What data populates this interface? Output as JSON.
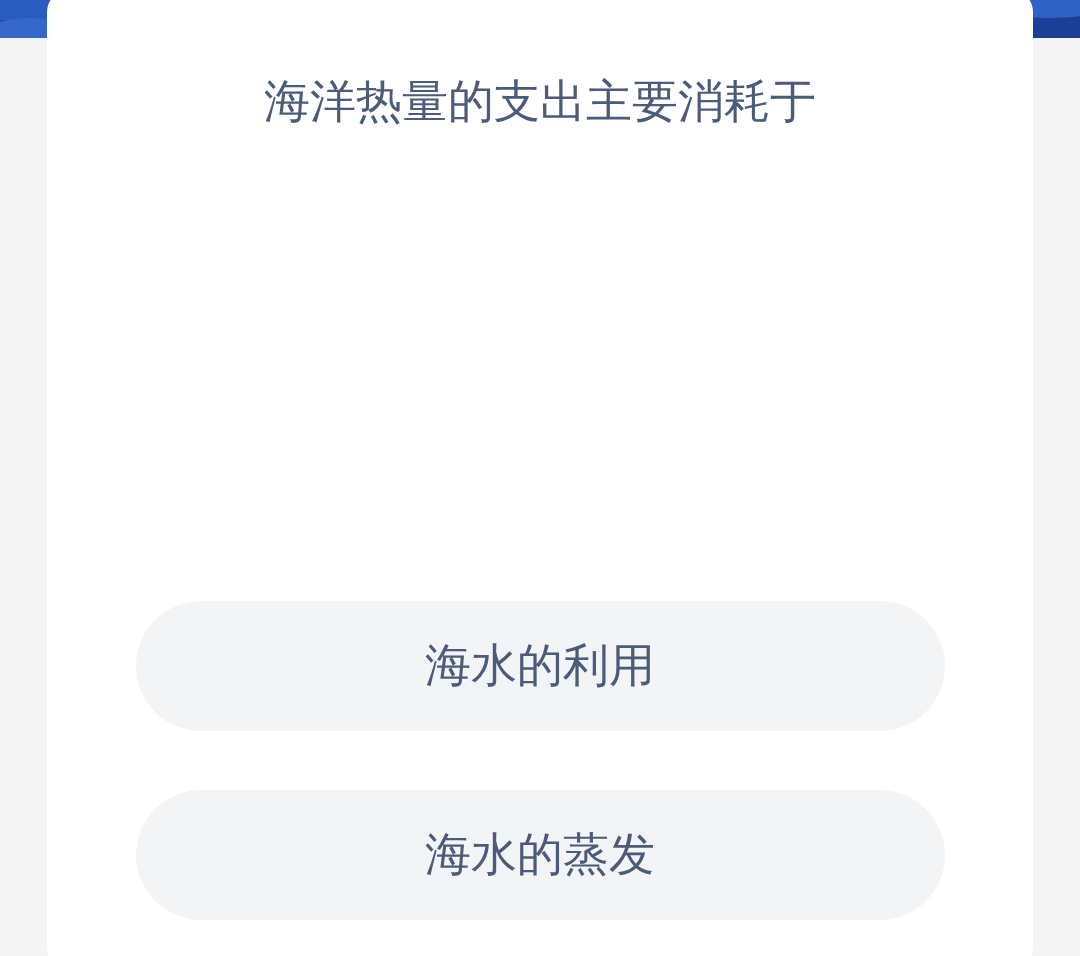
{
  "question": "海洋热量的支出主要消耗于",
  "options": [
    {
      "label": "海水的利用"
    },
    {
      "label": "海水的蒸发"
    }
  ]
}
